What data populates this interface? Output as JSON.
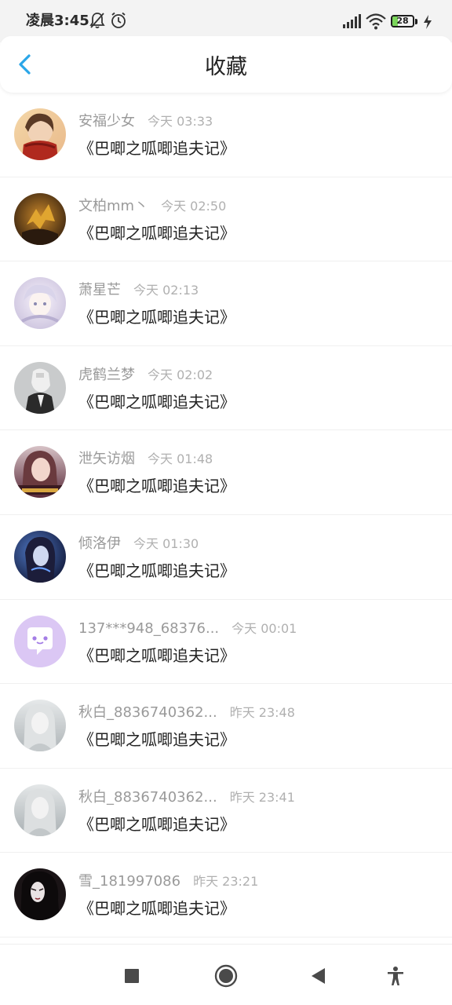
{
  "status_bar": {
    "time": "凌晨3:45",
    "battery": "28",
    "battery_level": 0.28,
    "icons": [
      "bell-off-icon",
      "alarm-icon",
      "signal-icon",
      "wifi-icon",
      "battery-icon",
      "charging-icon"
    ]
  },
  "header": {
    "title": "收藏",
    "back_icon": "chevron-left-icon",
    "accent_color": "#2aa6e8"
  },
  "items": [
    {
      "name": "安福少女",
      "time": "今天 03:33",
      "text": "《巴唧之呱唧追夫记》",
      "avatar": "avatar-photo"
    },
    {
      "name": "文柏mm丶",
      "time": "今天 02:50",
      "text": "《巴唧之呱唧追夫记》",
      "avatar": "avatar-photo"
    },
    {
      "name": "萧星芒",
      "time": "今天 02:13",
      "text": "《巴唧之呱唧追夫记》",
      "avatar": "avatar-photo"
    },
    {
      "name": "虎鹤兰梦",
      "time": "今天 02:02",
      "text": "《巴唧之呱唧追夫记》",
      "avatar": "avatar-photo"
    },
    {
      "name": "泄矢访烟",
      "time": "今天 01:48",
      "text": "《巴唧之呱唧追夫记》",
      "avatar": "avatar-photo"
    },
    {
      "name": "倾洛伊",
      "time": "今天 01:30",
      "text": "《巴唧之呱唧追夫记》",
      "avatar": "avatar-photo"
    },
    {
      "name": "137***948_68376...",
      "time": "今天 00:01",
      "text": "《巴唧之呱唧追夫记》",
      "avatar": "default-chat-avatar-icon"
    },
    {
      "name": "秋白_8836740362...",
      "time": "昨天 23:48",
      "text": "《巴唧之呱唧追夫记》",
      "avatar": "avatar-photo"
    },
    {
      "name": "秋白_8836740362...",
      "time": "昨天 23:41",
      "text": "《巴唧之呱唧追夫记》",
      "avatar": "avatar-photo"
    },
    {
      "name": "雪_181997086",
      "time": "昨天 23:21",
      "text": "《巴唧之呱唧追夫记》",
      "avatar": "avatar-photo"
    }
  ],
  "nav_bar": {
    "icons": [
      "recents-square-icon",
      "home-circle-icon",
      "back-triangle-icon",
      "accessibility-icon"
    ]
  }
}
